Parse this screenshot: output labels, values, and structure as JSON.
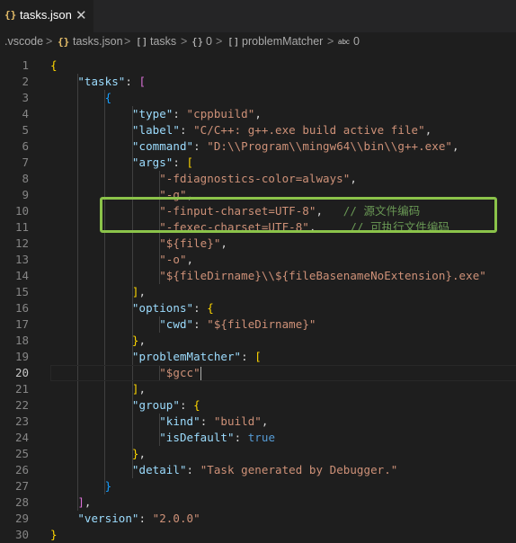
{
  "tab": {
    "icon": "{}",
    "label": "tasks.json",
    "close": "✕"
  },
  "breadcrumb": {
    "folder": ".vscode",
    "file_icon": "{}",
    "file": "tasks.json",
    "tasks_icon": "[]",
    "tasks": "tasks",
    "obj_icon": "{}",
    "index": "0",
    "pm_icon": "[]",
    "problemMatcher": "problemMatcher",
    "abc_icon": "abc",
    "item": "0",
    "separator": ">"
  },
  "editor": {
    "active_line": 20,
    "lines": [
      [
        [
          "b1",
          "{"
        ]
      ],
      [
        [
          "p",
          "    "
        ],
        [
          "k",
          "\"tasks\""
        ],
        [
          "p",
          ": "
        ],
        [
          "b2",
          "["
        ]
      ],
      [
        [
          "p",
          "        "
        ],
        [
          "b3",
          "{"
        ]
      ],
      [
        [
          "p",
          "            "
        ],
        [
          "k",
          "\"type\""
        ],
        [
          "p",
          ": "
        ],
        [
          "s",
          "\"cppbuild\""
        ],
        [
          "p",
          ","
        ]
      ],
      [
        [
          "p",
          "            "
        ],
        [
          "k",
          "\"label\""
        ],
        [
          "p",
          ": "
        ],
        [
          "s",
          "\"C/C++: g++.exe build active file\""
        ],
        [
          "p",
          ","
        ]
      ],
      [
        [
          "p",
          "            "
        ],
        [
          "k",
          "\"command\""
        ],
        [
          "p",
          ": "
        ],
        [
          "s",
          "\"D:\\\\Program\\\\mingw64\\\\bin\\\\g++.exe\""
        ],
        [
          "p",
          ","
        ]
      ],
      [
        [
          "p",
          "            "
        ],
        [
          "k",
          "\"args\""
        ],
        [
          "p",
          ": "
        ],
        [
          "b1",
          "["
        ]
      ],
      [
        [
          "p",
          "                "
        ],
        [
          "s",
          "\"-fdiagnostics-color=always\""
        ],
        [
          "p",
          ","
        ]
      ],
      [
        [
          "p",
          "                "
        ],
        [
          "s",
          "\"-g\""
        ],
        [
          "p",
          ","
        ]
      ],
      [
        [
          "p",
          "                "
        ],
        [
          "s",
          "\"-finput-charset=UTF-8\""
        ],
        [
          "p",
          ",   "
        ],
        [
          "c",
          "// 源文件编码"
        ]
      ],
      [
        [
          "p",
          "                "
        ],
        [
          "s",
          "\"-fexec-charset=UTF-8\""
        ],
        [
          "p",
          ",     "
        ],
        [
          "c",
          "// 可执行文件编码"
        ]
      ],
      [
        [
          "p",
          "                "
        ],
        [
          "s",
          "\"${file}\""
        ],
        [
          "p",
          ","
        ]
      ],
      [
        [
          "p",
          "                "
        ],
        [
          "s",
          "\"-o\""
        ],
        [
          "p",
          ","
        ]
      ],
      [
        [
          "p",
          "                "
        ],
        [
          "s",
          "\"${fileDirname}\\\\${fileBasenameNoExtension}.exe\""
        ]
      ],
      [
        [
          "p",
          "            "
        ],
        [
          "b1",
          "]"
        ],
        [
          "p",
          ","
        ]
      ],
      [
        [
          "p",
          "            "
        ],
        [
          "k",
          "\"options\""
        ],
        [
          "p",
          ": "
        ],
        [
          "b1",
          "{"
        ]
      ],
      [
        [
          "p",
          "                "
        ],
        [
          "k",
          "\"cwd\""
        ],
        [
          "p",
          ": "
        ],
        [
          "s",
          "\"${fileDirname}\""
        ]
      ],
      [
        [
          "p",
          "            "
        ],
        [
          "b1",
          "}"
        ],
        [
          "p",
          ","
        ]
      ],
      [
        [
          "p",
          "            "
        ],
        [
          "k",
          "\"problemMatcher\""
        ],
        [
          "p",
          ": "
        ],
        [
          "b1",
          "["
        ]
      ],
      [
        [
          "p",
          "                "
        ],
        [
          "s",
          "\"$gcc\""
        ]
      ],
      [
        [
          "p",
          "            "
        ],
        [
          "b1",
          "]"
        ],
        [
          "p",
          ","
        ]
      ],
      [
        [
          "p",
          "            "
        ],
        [
          "k",
          "\"group\""
        ],
        [
          "p",
          ": "
        ],
        [
          "b1",
          "{"
        ]
      ],
      [
        [
          "p",
          "                "
        ],
        [
          "k",
          "\"kind\""
        ],
        [
          "p",
          ": "
        ],
        [
          "s",
          "\"build\""
        ],
        [
          "p",
          ","
        ]
      ],
      [
        [
          "p",
          "                "
        ],
        [
          "k",
          "\"isDefault\""
        ],
        [
          "p",
          ": "
        ],
        [
          "kw",
          "true"
        ]
      ],
      [
        [
          "p",
          "            "
        ],
        [
          "b1",
          "}"
        ],
        [
          "p",
          ","
        ]
      ],
      [
        [
          "p",
          "            "
        ],
        [
          "k",
          "\"detail\""
        ],
        [
          "p",
          ": "
        ],
        [
          "s",
          "\"Task generated by Debugger.\""
        ]
      ],
      [
        [
          "p",
          "        "
        ],
        [
          "b3",
          "}"
        ]
      ],
      [
        [
          "p",
          "    "
        ],
        [
          "b2",
          "]"
        ],
        [
          "p",
          ","
        ]
      ],
      [
        [
          "p",
          "    "
        ],
        [
          "k",
          "\"version\""
        ],
        [
          "p",
          ": "
        ],
        [
          "s",
          "\"2.0.0\""
        ]
      ],
      [
        [
          "b1",
          "}"
        ]
      ]
    ]
  },
  "annotation": {
    "color": "#8bc34a",
    "lines": [
      10,
      11
    ]
  },
  "colors": {
    "background": "#1e1e1e",
    "key": "#9cdcfe",
    "string": "#ce9178",
    "comment": "#6a9955",
    "bracket_gold": "#ffd700",
    "bracket_purple": "#da70d6",
    "bracket_blue": "#179fff",
    "keyword": "#569cd6"
  }
}
